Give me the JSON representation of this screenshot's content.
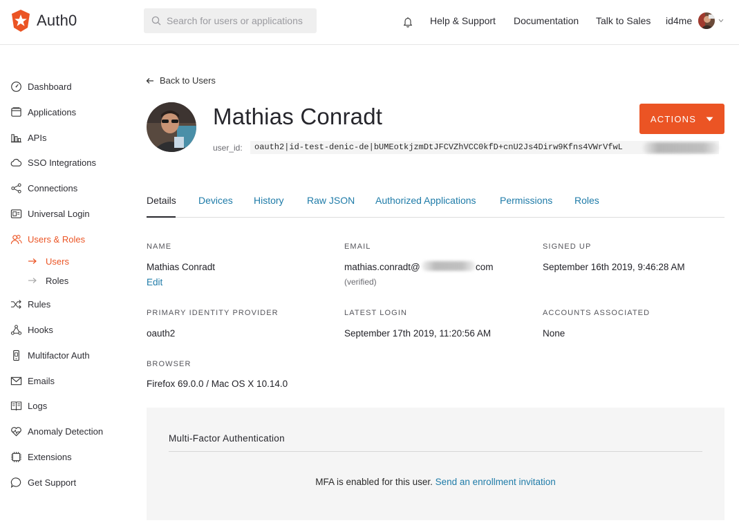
{
  "header": {
    "brand": "Auth0",
    "search_placeholder": "Search for users or applications",
    "help": "Help & Support",
    "docs": "Documentation",
    "sales": "Talk to Sales",
    "tenant": "id4me"
  },
  "sidebar": {
    "items": [
      {
        "label": "Dashboard",
        "icon": "dashboard-icon"
      },
      {
        "label": "Applications",
        "icon": "applications-icon"
      },
      {
        "label": "APIs",
        "icon": "apis-icon"
      },
      {
        "label": "SSO Integrations",
        "icon": "cloud-icon"
      },
      {
        "label": "Connections",
        "icon": "connections-icon"
      },
      {
        "label": "Universal Login",
        "icon": "universal-login-icon"
      },
      {
        "label": "Users & Roles",
        "icon": "users-icon"
      },
      {
        "label": "Rules",
        "icon": "rules-icon"
      },
      {
        "label": "Hooks",
        "icon": "hooks-icon"
      },
      {
        "label": "Multifactor Auth",
        "icon": "phone-icon"
      },
      {
        "label": "Emails",
        "icon": "email-icon"
      },
      {
        "label": "Logs",
        "icon": "logs-icon"
      },
      {
        "label": "Anomaly Detection",
        "icon": "heart-icon"
      },
      {
        "label": "Extensions",
        "icon": "chip-icon"
      },
      {
        "label": "Get Support",
        "icon": "chat-icon"
      }
    ],
    "subitems": [
      {
        "label": "Users"
      },
      {
        "label": "Roles"
      }
    ]
  },
  "user": {
    "back_label": "Back to Users",
    "name": "Mathias Conradt",
    "user_id_label": "user_id:",
    "user_id": "oauth2|id-test-denic-de|bUMEotkjzmDtJFCVZhVCC0kfD+cnU2Js4Dirw9Kfns4VWrVfwL",
    "actions_label": "ACTIONS"
  },
  "tabs": [
    "Details",
    "Devices",
    "History",
    "Raw JSON",
    "Authorized Applications",
    "Permissions",
    "Roles"
  ],
  "details": {
    "name_label": "NAME",
    "name_value": "Mathias Conradt",
    "edit_label": "Edit",
    "email_label": "EMAIL",
    "email_prefix": "mathias.conradt@",
    "email_suffix": "com",
    "email_verified": "(verified)",
    "signed_up_label": "SIGNED UP",
    "signed_up_value": "September 16th 2019, 9:46:28 AM",
    "idp_label": "PRIMARY IDENTITY PROVIDER",
    "idp_value": "oauth2",
    "latest_login_label": "LATEST LOGIN",
    "latest_login_value": "September 17th 2019, 11:20:56 AM",
    "accounts_label": "ACCOUNTS ASSOCIATED",
    "accounts_value": "None",
    "browser_label": "BROWSER",
    "browser_value": "Firefox 69.0.0 / Mac OS X 10.14.0"
  },
  "mfa": {
    "title": "Multi-Factor Authentication",
    "text": "MFA is enabled for this user.",
    "link": "Send an enrollment invitation"
  },
  "colors": {
    "accent": "#eb5424",
    "link": "#1e7ba8"
  }
}
